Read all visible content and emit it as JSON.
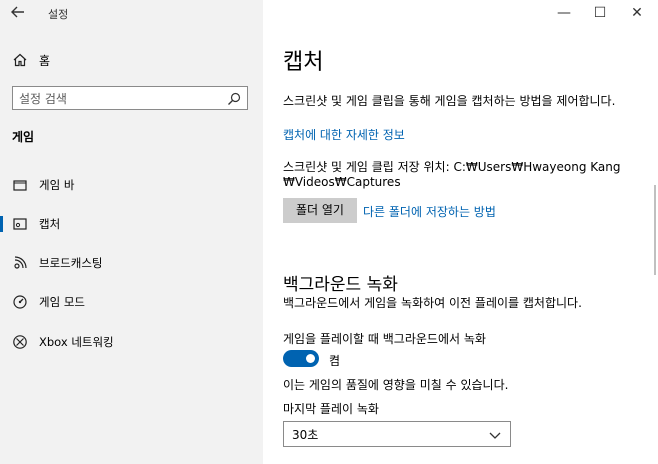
{
  "window": {
    "title": "설정",
    "back_icon": "back-arrow-icon",
    "minimize_glyph": "—",
    "maximize_glyph": "☐",
    "close_glyph": "✕"
  },
  "sidebar": {
    "home_label": "홈",
    "search_placeholder": "설정 검색",
    "section_title": "게임",
    "items": [
      {
        "label": "게임 바",
        "icon": "game-bar-icon",
        "active": false
      },
      {
        "label": "캡처",
        "icon": "capture-icon",
        "active": true
      },
      {
        "label": "브로드캐스팅",
        "icon": "broadcast-icon",
        "active": false
      },
      {
        "label": "게임 모드",
        "icon": "game-mode-icon",
        "active": false
      },
      {
        "label": "Xbox 네트워킹",
        "icon": "xbox-icon",
        "active": false
      }
    ]
  },
  "main": {
    "title": "캡처",
    "description": "스크린샷 및 게임 클립을 통해 게임을 캡처하는 방법을 제어합니다.",
    "more_info_link": "캡처에 대한 자세한 정보",
    "save_location_line1": "스크린샷 및 게임 클립 저장 위치: C:₩Users₩Hwayeong Kang",
    "save_location_line2": "₩Videos₩Captures",
    "open_folder_button": "폴더 열기",
    "other_folder_link": "다른 폴더에 저장하는 방법",
    "bg_title": "백그라운드 녹화",
    "bg_description": "백그라운드에서 게임을 녹화하여 이전 플레이를 캡처합니다.",
    "bg_toggle_label": "게임을 플레이할 때 백그라운드에서 녹화",
    "bg_toggle_state": "켬",
    "bg_quality_note": "이는 게임의 품질에 영향을 미칠 수 있습니다.",
    "last_play_label": "마지막 플레이 녹화",
    "last_play_value": "30초"
  },
  "colors": {
    "accent": "#0063b1",
    "sidebar_bg": "#f2f2f2"
  }
}
